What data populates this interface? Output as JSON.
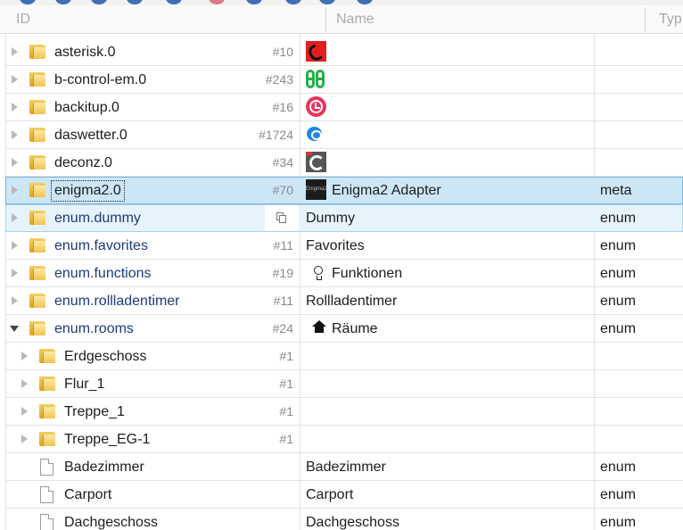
{
  "header": {
    "id_col": "ID",
    "name_col": "Name",
    "type_col": "Typ"
  },
  "rows": [
    {
      "id": "asterisk.0",
      "count": "#10",
      "name": "",
      "type": "",
      "icon": "asterisk-phone-icon"
    },
    {
      "id": "b-control-em.0",
      "count": "#243",
      "name": "",
      "type": "",
      "icon": "b-control-logo-icon"
    },
    {
      "id": "backitup.0",
      "count": "#16",
      "name": "",
      "type": "",
      "icon": "backitup-clock-icon"
    },
    {
      "id": "daswetter.0",
      "count": "#1724",
      "name": "",
      "type": "",
      "icon": "daswetter-cloud-icon"
    },
    {
      "id": "deconz.0",
      "count": "#34",
      "name": "",
      "type": "",
      "icon": "deconz-logo-icon"
    },
    {
      "id": "enigma2.0",
      "count": "#70",
      "name": "Enigma2 Adapter",
      "type": "meta",
      "icon": "enigma2-logo-icon",
      "icon_text": "Enigma2"
    },
    {
      "id": "enum.dummy",
      "count": "",
      "name": "Dummy",
      "type": "enum"
    },
    {
      "id": "enum.favorites",
      "count": "#11",
      "name": "Favorites",
      "type": "enum"
    },
    {
      "id": "enum.functions",
      "count": "#19",
      "name": "Funktionen",
      "type": "enum",
      "icon": "lightbulb-icon"
    },
    {
      "id": "enum.rollladentimer",
      "count": "#11",
      "name": "Rollladentimer",
      "type": "enum"
    },
    {
      "id": "enum.rooms",
      "count": "#24",
      "name": "Räume",
      "type": "enum",
      "icon": "home-icon"
    },
    {
      "id": "Erdgeschoss",
      "count": "#1",
      "name": "",
      "type": ""
    },
    {
      "id": "Flur_1",
      "count": "#1",
      "name": "",
      "type": ""
    },
    {
      "id": "Treppe_1",
      "count": "#1",
      "name": "",
      "type": ""
    },
    {
      "id": "Treppe_EG-1",
      "count": "#1",
      "name": "",
      "type": ""
    },
    {
      "id": "Badezimmer",
      "count": "",
      "name": "Badezimmer",
      "type": "enum"
    },
    {
      "id": "Carport",
      "count": "",
      "name": "Carport",
      "type": "enum"
    },
    {
      "id": "Dachgeschoss",
      "count": "",
      "name": "Dachgeschoss",
      "type": "enum"
    }
  ],
  "colors": {
    "selected_row": "#cde6f6",
    "hover_row": "#e7f3fb",
    "enum_text": "#1c3a79",
    "folder": "#f1c451"
  }
}
